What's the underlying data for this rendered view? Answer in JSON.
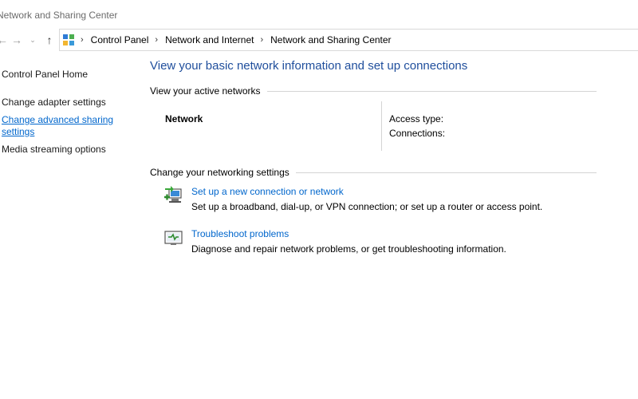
{
  "window": {
    "title": "Network and Sharing Center"
  },
  "nav": {
    "back_icon": "arrow-left-icon",
    "forward_icon": "arrow-right-icon",
    "recent_icon": "chevron-down-icon",
    "up_icon": "arrow-up-icon"
  },
  "address": {
    "icon": "control-panel-icon",
    "breadcrumbs": [
      "Control Panel",
      "Network and Internet",
      "Network and Sharing Center"
    ]
  },
  "sidebar": {
    "items": [
      {
        "label": "Control Panel Home"
      },
      {
        "label": "Change adapter settings"
      },
      {
        "label": "Change advanced sharing settings"
      },
      {
        "label": "Media streaming options"
      }
    ]
  },
  "main": {
    "title": "View your basic network information and set up connections",
    "active_networks": {
      "heading": "View your active networks",
      "network_name": "Network",
      "access_type_label": "Access type:",
      "connections_label": "Connections:"
    },
    "settings": {
      "heading": "Change your networking settings",
      "tasks": [
        {
          "icon": "new-connection-icon",
          "link": "Set up a new connection or network",
          "description": "Set up a broadband, dial-up, or VPN connection; or set up a router or access point."
        },
        {
          "icon": "troubleshoot-icon",
          "link": "Troubleshoot problems",
          "description": "Diagnose and repair network problems, or get troubleshooting information."
        }
      ]
    }
  },
  "colors": {
    "link": "#0066cc",
    "title": "#1f4e9c",
    "rule": "#d4d4d4"
  }
}
